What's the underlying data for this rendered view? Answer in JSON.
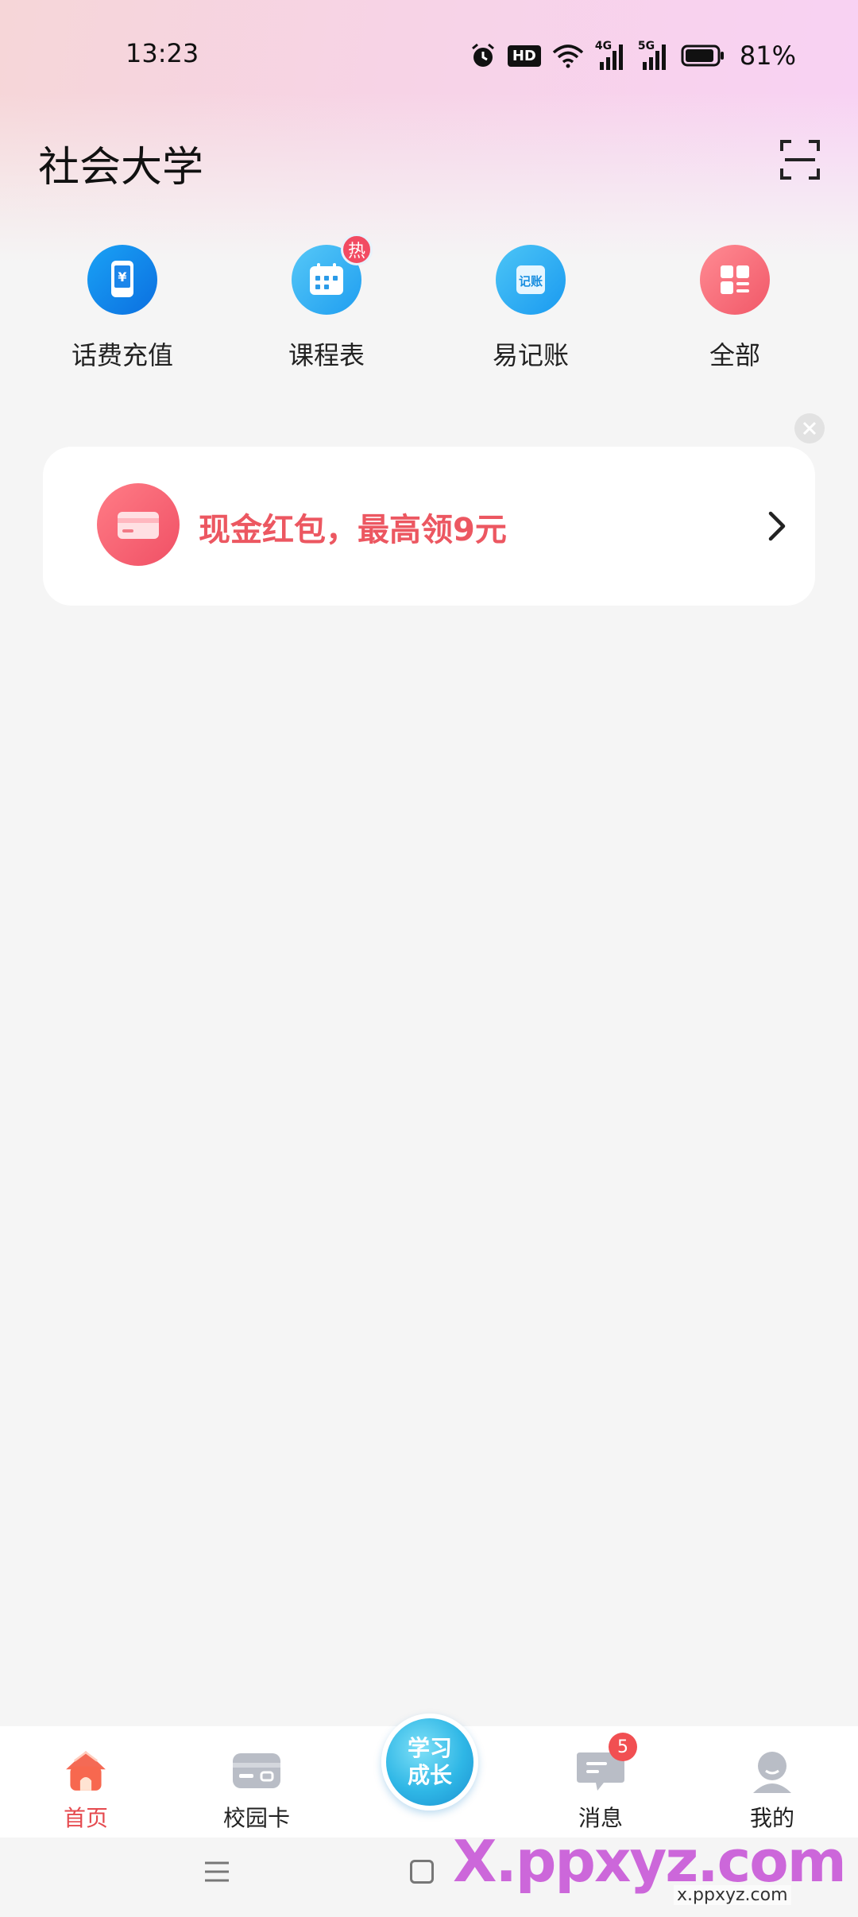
{
  "status_bar": {
    "time": "13:23",
    "hd_label": "HD",
    "net_4g": "4G",
    "net_5g": "5G",
    "battery": "81%"
  },
  "header": {
    "title": "社会大学"
  },
  "quick_actions": [
    {
      "label": "话费充值",
      "icon": "phone-recharge-icon",
      "badge": ""
    },
    {
      "label": "课程表",
      "icon": "calendar-icon",
      "badge": "热"
    },
    {
      "label": "易记账",
      "icon": "ledger-icon",
      "badge": ""
    },
    {
      "label": "全部",
      "icon": "grid-icon",
      "badge": ""
    }
  ],
  "banner": {
    "text": "现金红包，最高领9元"
  },
  "bottom_nav": {
    "home": "首页",
    "campus_card": "校园卡",
    "center_line1": "学习",
    "center_line2": "成长",
    "messages": "消息",
    "messages_badge": "5",
    "mine": "我的"
  },
  "watermark": {
    "main": "X.ppxyz.com",
    "sub": "x.ppxyz.com"
  },
  "colors": {
    "accent": "#e54a4f",
    "banner_text": "#ec5761",
    "background": "#f5f5f5"
  }
}
